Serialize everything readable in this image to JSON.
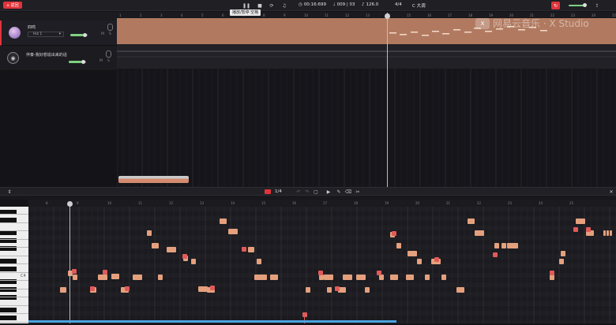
{
  "toolbar": {
    "red_button_label": "返回",
    "time": "00:16:699",
    "measure": "009 | 03",
    "tempo": "126.0",
    "signature": "4/4",
    "key": "C 大调",
    "tooltip": "播放/暂停 空格"
  },
  "watermark": {
    "logo": "X",
    "text": "网易云音乐 · X Studio"
  },
  "tracks": [
    {
      "name": "四鸣",
      "dropdown": "Hiz 1",
      "mute": "M",
      "solo": "S"
    },
    {
      "name": "伴奏-我好想说出来的话",
      "mute": "M",
      "solo": "S"
    }
  ],
  "ruler": {
    "ticks": [
      "1",
      "2",
      "3",
      "4",
      "5",
      "6",
      "7",
      "8",
      "9",
      "10",
      "11",
      "12",
      "13",
      "14",
      "15",
      "16",
      "17",
      "18",
      "19",
      "20",
      "21",
      "22",
      "23",
      "24",
      "25"
    ]
  },
  "piano_roll": {
    "quantize": "1/4",
    "c4_label": "C4",
    "ruler_ticks": [
      "8",
      "9",
      "10",
      "11",
      "12",
      "13",
      "14",
      "15",
      "16",
      "17",
      "18",
      "19",
      "20",
      "21",
      "22",
      "23",
      "24",
      "25"
    ]
  },
  "colors": {
    "accent_red": "#e0343c",
    "note": "#e4a07d",
    "lane": "#b17a60",
    "progress": "#4aa3e0"
  }
}
